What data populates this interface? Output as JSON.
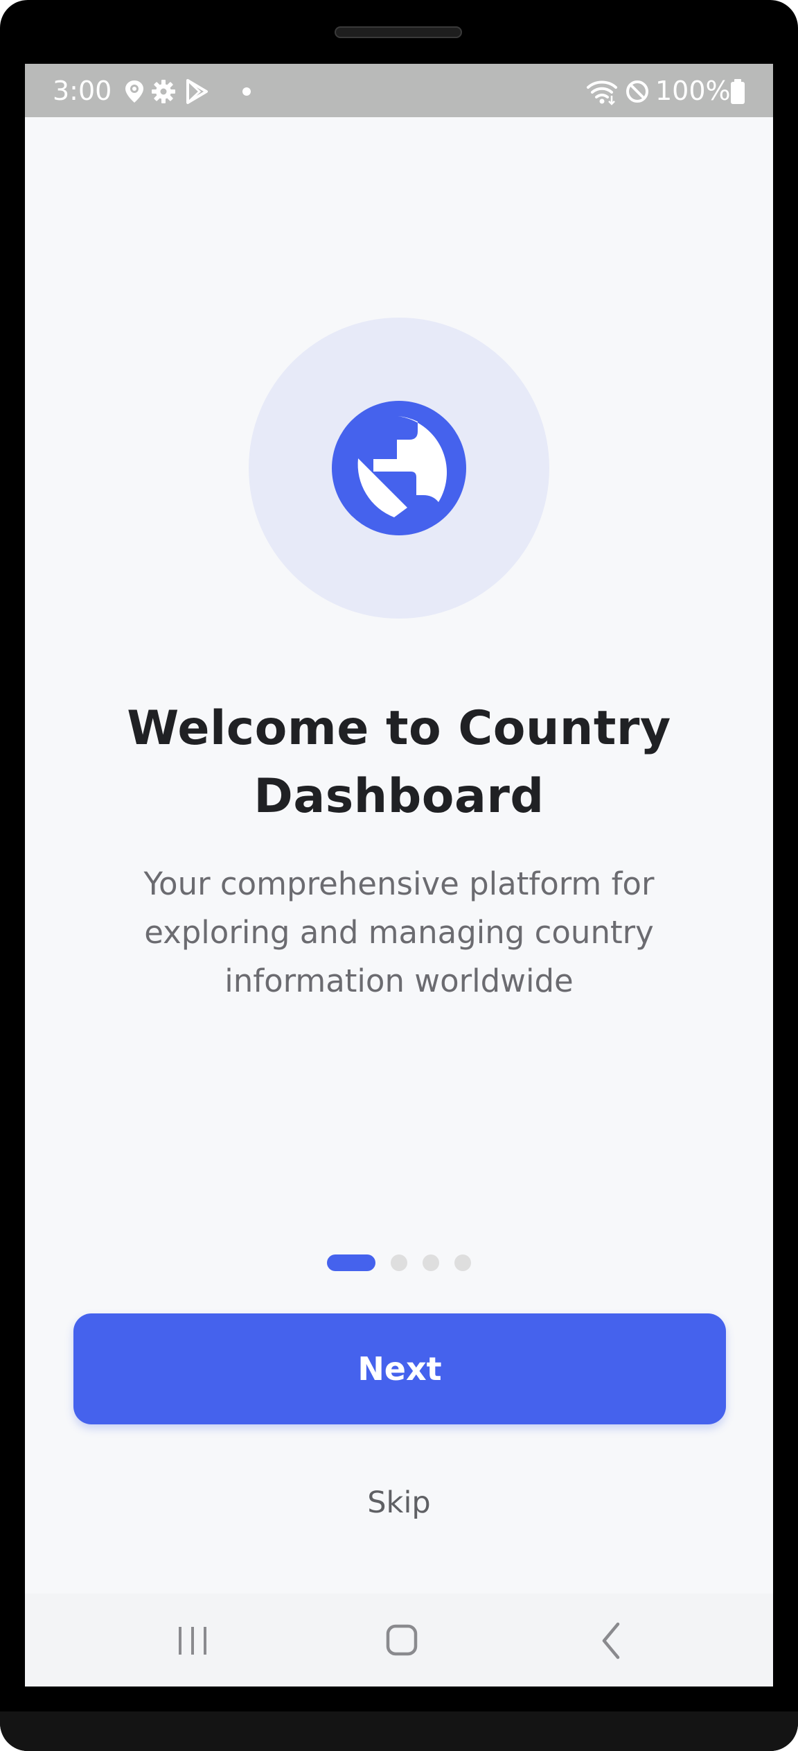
{
  "status_bar": {
    "time": "3:00",
    "battery": "100%",
    "icons": [
      "location-icon",
      "settings-gear-icon",
      "play-store-icon",
      "notification-dot-icon",
      "wifi-icon",
      "do-not-disturb-icon",
      "battery-icon"
    ]
  },
  "onboarding": {
    "hero_icon": "globe-icon",
    "title": "Welcome to Country Dashboard",
    "subtitle": "Your comprehensive platform for exploring and managing country information worldwide",
    "page_indicator": {
      "total": 4,
      "current": 1
    },
    "next_label": "Next",
    "skip_label": "Skip"
  },
  "nav_bar": {
    "buttons": [
      "recent-apps-icon",
      "home-icon",
      "back-icon"
    ]
  },
  "colors": {
    "accent": "#4562ed",
    "hero_bg": "#e7eaf8",
    "screen_bg": "#f7f8fa",
    "status_bar_bg": "#b9bab9",
    "title_text": "#202124",
    "body_text": "#6b6b70",
    "inactive_dot": "#dedede"
  }
}
